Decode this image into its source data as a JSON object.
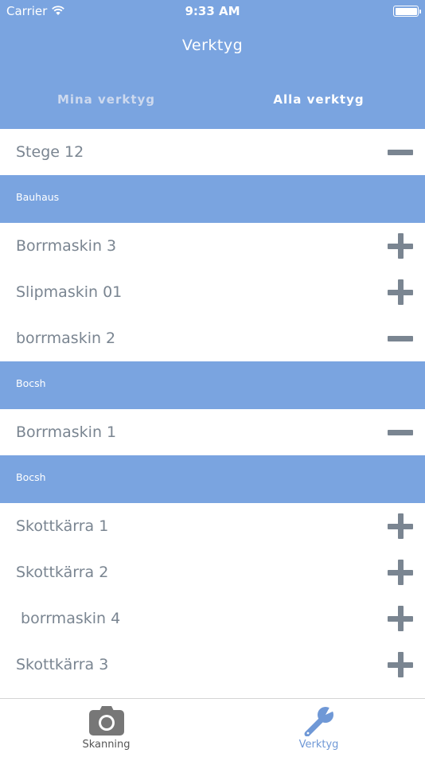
{
  "status_bar": {
    "carrier": "Carrier",
    "time": "9:33 AM"
  },
  "nav": {
    "title": "Verktyg"
  },
  "segments": [
    {
      "label": "Mina verktyg",
      "selected": false
    },
    {
      "label": "Alla verktyg",
      "selected": true
    }
  ],
  "list": {
    "top_row": {
      "label": "Stege 12",
      "action": "remove"
    },
    "sections": [
      {
        "header": "Bauhaus",
        "rows": [
          {
            "label": "Borrmaskin 3",
            "action": "add"
          },
          {
            "label": "Slipmaskin 01",
            "action": "add"
          },
          {
            "label": "borrmaskin 2",
            "action": "remove"
          }
        ]
      },
      {
        "header": "Bocsh",
        "rows": [
          {
            "label": "Borrmaskin 1",
            "action": "remove"
          }
        ]
      },
      {
        "header": "Bocsh",
        "rows": [
          {
            "label": "Skottkärra 1",
            "action": "add"
          },
          {
            "label": "Skottkärra 2",
            "action": "add"
          },
          {
            "label": " borrmaskin 4",
            "action": "add"
          },
          {
            "label": "Skottkärra 3",
            "action": "add"
          }
        ]
      }
    ]
  },
  "tabbar": [
    {
      "label": "Skanning",
      "icon": "camera-icon",
      "selected": false
    },
    {
      "label": "Verktyg",
      "icon": "wrench-icon",
      "selected": true
    }
  ],
  "colors": {
    "accent": "#7aa4e0",
    "text": "#7a8591",
    "tab_selected": "#6f98d6"
  }
}
